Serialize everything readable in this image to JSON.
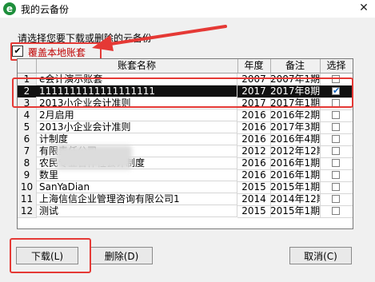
{
  "window": {
    "title": "我的云备份",
    "close_glyph": "✕",
    "app_icon_glyph": "e"
  },
  "prompt": "请选择您要下载或删除的云备份",
  "overwrite_checkbox": {
    "label": "覆盖本地账套",
    "checked": true,
    "check_glyph": "✔"
  },
  "table": {
    "headers": {
      "name": "账套名称",
      "year": "年度",
      "note": "备注",
      "select": "选择"
    },
    "rows": [
      {
        "num": "1",
        "name": "e会计演示账套",
        "year": "2007",
        "note": "2007年1期",
        "selected": false
      },
      {
        "num": "2",
        "name": "1111111111111111111",
        "year": "2017",
        "note": "2017年8期",
        "selected": true
      },
      {
        "num": "3",
        "name": "2013小企业会计准则",
        "year": "2017",
        "note": "2017年1期",
        "selected": false
      },
      {
        "num": "4",
        "name": "2月启用",
        "year": "2016",
        "note": "2016年2期",
        "selected": false
      },
      {
        "num": "5",
        "name": "2013小企业会计准则",
        "year": "2016",
        "note": "2017年3期",
        "selected": false
      },
      {
        "num": "6",
        "name": "计制度",
        "year": "2016",
        "note": "2016年4期",
        "selected": false
      },
      {
        "num": "7",
        "name": "有限责任公司",
        "year": "2012",
        "note": "2012年12期",
        "selected": false
      },
      {
        "num": "8",
        "name": "农民专业合作社会计制度",
        "year": "2016",
        "note": "2016年1期",
        "selected": false
      },
      {
        "num": "9",
        "name": "数里",
        "year": "2016",
        "note": "2016年1期",
        "selected": false
      },
      {
        "num": "10",
        "name": "SanYaDian",
        "year": "2015",
        "note": "2015年1期",
        "selected": false
      },
      {
        "num": "11",
        "name": "上海信信企业管理咨询有限公司1",
        "year": "2014",
        "note": "2014年12期",
        "selected": false
      },
      {
        "num": "12",
        "name": "测试",
        "year": "2015",
        "note": "2015年1期",
        "selected": false
      }
    ]
  },
  "buttons": {
    "download": "下载(L)",
    "delete": "删除(D)",
    "cancel": "取消(C)"
  },
  "colors": {
    "annotation": "#e53935",
    "selection_bg": "#111111",
    "checkbox_label": "#c00000"
  }
}
